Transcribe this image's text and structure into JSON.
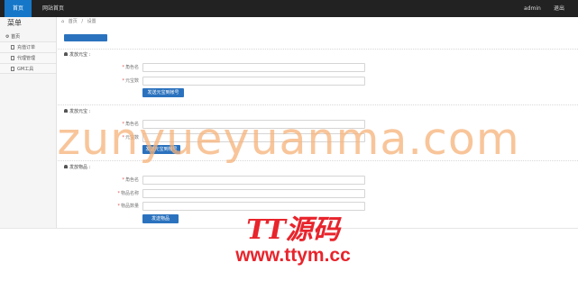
{
  "topbar": {
    "home": "首页",
    "site_home": "网站首页",
    "user": "admin",
    "logout": "退出"
  },
  "sidebar": {
    "title": "菜单",
    "home": "首页",
    "items": [
      {
        "label": "充值订单"
      },
      {
        "label": "代理管理"
      },
      {
        "label": "GM工具"
      }
    ]
  },
  "breadcrumb": {
    "home": "首页",
    "separator": "/",
    "current": "设置"
  },
  "sections": [
    {
      "title": "发放元宝 :",
      "fields": [
        {
          "label": "角色名"
        },
        {
          "label": "元宝数"
        }
      ],
      "button": "发送元宝到帐号"
    },
    {
      "title": "发放元宝 :",
      "fields": [
        {
          "label": "角色名"
        },
        {
          "label": "元宝数"
        }
      ],
      "button": "发送元宝到帐号"
    },
    {
      "title": "发放物品 :",
      "fields": [
        {
          "label": "角色名"
        },
        {
          "label": "物品名称"
        },
        {
          "label": "物品数量"
        }
      ],
      "button": "发送物品"
    }
  ],
  "watermark": {
    "text": "zunyueyuanma.com",
    "logo": "TT源码",
    "url": "www.ttym.cc"
  },
  "colors": {
    "topbar": "#222222",
    "accent": "#2b72be",
    "watermark_text": "#f6b278",
    "watermark_logo": "#e8242c"
  }
}
